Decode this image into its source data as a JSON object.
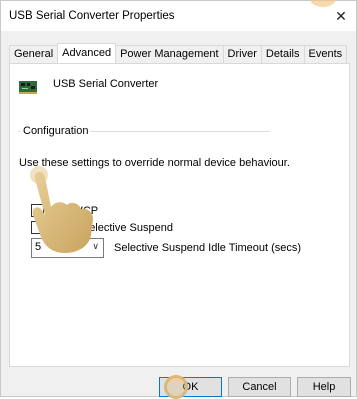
{
  "window": {
    "title": "USB Serial Converter Properties",
    "close_glyph": "✕"
  },
  "tabs": [
    {
      "label": "General"
    },
    {
      "label": "Advanced"
    },
    {
      "label": "Power Management"
    },
    {
      "label": "Driver"
    },
    {
      "label": "Details"
    },
    {
      "label": "Events"
    }
  ],
  "active_tab": "Advanced",
  "device": {
    "name": "USB Serial Converter",
    "icon": "circuit-board-icon"
  },
  "configuration": {
    "group_label": "Configuration",
    "description": "Use these settings to override normal device behaviour.",
    "load_vcp": {
      "label": "Load VCP",
      "checked": false
    },
    "selective_suspend": {
      "label": "able Selective Suspend",
      "checked": false
    },
    "timeout": {
      "value": "5",
      "label": "Selective Suspend Idle Timeout (secs)"
    }
  },
  "buttons": {
    "ok": "OK",
    "cancel": "Cancel",
    "help": "Help"
  },
  "colors": {
    "accent": "#0078d7",
    "hand": "#d9b97a"
  }
}
